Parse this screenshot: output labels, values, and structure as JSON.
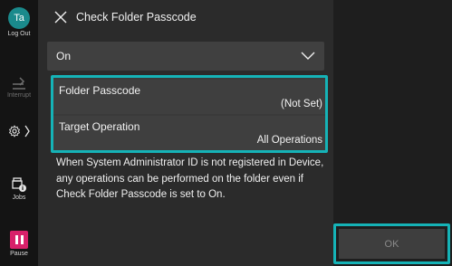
{
  "rail": {
    "user_initials": "Ta",
    "logout_label": "Log Out",
    "interrupt_label": "Interrupt",
    "jobs_label": "Jobs",
    "pause_label": "Pause",
    "icons": [
      "user-avatar",
      "interrupt-icon",
      "gear-icon",
      "chevron-right-icon",
      "jobs-icon",
      "pause-icon"
    ]
  },
  "header": {
    "title": "Check Folder Passcode",
    "close_icon": "close-icon"
  },
  "dropdown": {
    "selected": "On",
    "icon": "chevron-down-icon"
  },
  "settings": [
    {
      "label": "Folder Passcode",
      "value": "(Not Set)"
    },
    {
      "label": "Target Operation",
      "value": "All Operations"
    }
  ],
  "info_text": "When System Administrator ID is not registered in Device, any operations can be performed on the folder even if Check Folder Passcode is set to On.",
  "ok_label": "OK",
  "colors": {
    "accent": "#15b3b7",
    "avatar": "#1a8a8c",
    "pause": "#d8206a",
    "panel_bg": "#2b2b2b",
    "rail_bg": "#141414"
  }
}
